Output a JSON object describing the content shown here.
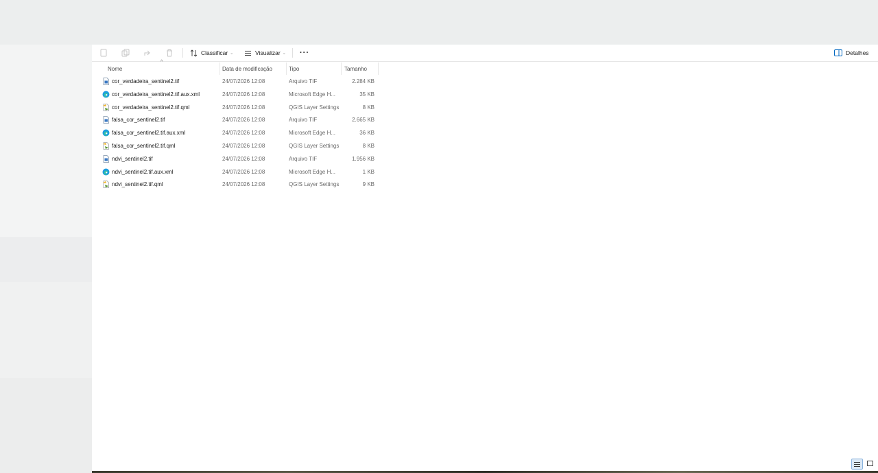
{
  "toolbar": {
    "sort_label": "Classificar",
    "view_label": "Visualizar",
    "more_label": "···",
    "details_label": "Detalhes"
  },
  "columns": {
    "name": "Nome",
    "modified": "Data de modificação",
    "type": "Tipo",
    "size": "Tamanho"
  },
  "files": [
    {
      "name": "cor_verdadeira_sentinel2.tif",
      "date": "24/07/2026 12:08",
      "type": "Arquivo TIF",
      "size": "2.284 KB",
      "icon": "tif-file-icon"
    },
    {
      "name": "cor_verdadeira_sentinel2.tif.aux.xml",
      "date": "24/07/2026 12:08",
      "type": "Microsoft Edge H...",
      "size": "35 KB",
      "icon": "edge-icon"
    },
    {
      "name": "cor_verdadeira_sentinel2.tif.qml",
      "date": "24/07/2026 12:08",
      "type": "QGIS Layer Settings",
      "size": "8 KB",
      "icon": "qgis-icon"
    },
    {
      "name": "falsa_cor_sentinel2.tif",
      "date": "24/07/2026 12:08",
      "type": "Arquivo TIF",
      "size": "2.665 KB",
      "icon": "tif-file-icon"
    },
    {
      "name": "falsa_cor_sentinel2.tif.aux.xml",
      "date": "24/07/2026 12:08",
      "type": "Microsoft Edge H...",
      "size": "36 KB",
      "icon": "edge-icon"
    },
    {
      "name": "falsa_cor_sentinel2.tif.qml",
      "date": "24/07/2026 12:08",
      "type": "QGIS Layer Settings",
      "size": "8 KB",
      "icon": "qgis-icon"
    },
    {
      "name": "ndvi_sentinel2.tif",
      "date": "24/07/2026 12:08",
      "type": "Arquivo TIF",
      "size": "1.956 KB",
      "icon": "tif-file-icon"
    },
    {
      "name": "ndvi_sentinel2.tif.aux.xml",
      "date": "24/07/2026 12:08",
      "type": "Microsoft Edge H...",
      "size": "1 KB",
      "icon": "edge-icon"
    },
    {
      "name": "ndvi_sentinel2.tif.qml",
      "date": "24/07/2026 12:08",
      "type": "QGIS Layer Settings",
      "size": "9 KB",
      "icon": "qgis-icon"
    }
  ],
  "colors": {
    "accent": "#0067c0",
    "window_bg": "#ffffff",
    "secondary_text": "#6a6a6a"
  }
}
